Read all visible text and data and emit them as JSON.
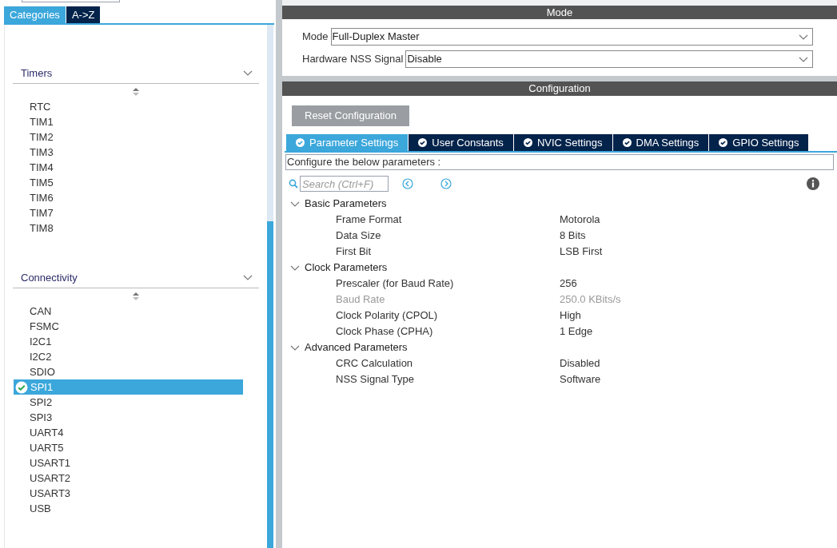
{
  "left_tabs": [
    {
      "label": "Categories",
      "selected": true
    },
    {
      "label": "A->Z",
      "selected": false
    }
  ],
  "categories": [
    {
      "label": "Timers",
      "expanded": true,
      "items": [
        {
          "label": "RTC",
          "selected": false,
          "configured": false
        },
        {
          "label": "TIM1",
          "selected": false,
          "configured": false
        },
        {
          "label": "TIM2",
          "selected": false,
          "configured": false
        },
        {
          "label": "TIM3",
          "selected": false,
          "configured": false
        },
        {
          "label": "TIM4",
          "selected": false,
          "configured": false
        },
        {
          "label": "TIM5",
          "selected": false,
          "configured": false
        },
        {
          "label": "TIM6",
          "selected": false,
          "configured": false
        },
        {
          "label": "TIM7",
          "selected": false,
          "configured": false
        },
        {
          "label": "TIM8",
          "selected": false,
          "configured": false
        }
      ]
    },
    {
      "label": "Connectivity",
      "expanded": true,
      "items": [
        {
          "label": "CAN",
          "selected": false,
          "configured": false
        },
        {
          "label": "FSMC",
          "selected": false,
          "configured": false
        },
        {
          "label": "I2C1",
          "selected": false,
          "configured": false
        },
        {
          "label": "I2C2",
          "selected": false,
          "configured": false
        },
        {
          "label": "SDIO",
          "selected": false,
          "configured": false
        },
        {
          "label": "SPI1",
          "selected": true,
          "configured": true
        },
        {
          "label": "SPI2",
          "selected": false,
          "configured": false
        },
        {
          "label": "SPI3",
          "selected": false,
          "configured": false
        },
        {
          "label": "UART4",
          "selected": false,
          "configured": false
        },
        {
          "label": "UART5",
          "selected": false,
          "configured": false
        },
        {
          "label": "USART1",
          "selected": false,
          "configured": false
        },
        {
          "label": "USART2",
          "selected": false,
          "configured": false
        },
        {
          "label": "USART3",
          "selected": false,
          "configured": false
        },
        {
          "label": "USB",
          "selected": false,
          "configured": false
        }
      ]
    }
  ],
  "mode": {
    "title": "Mode",
    "fields": [
      {
        "label": "Mode",
        "value": "Full-Duplex Master"
      },
      {
        "label": "Hardware NSS Signal",
        "value": "Disable"
      }
    ]
  },
  "configuration": {
    "title": "Configuration",
    "reset_button": "Reset Configuration",
    "tabs": [
      {
        "label": "Parameter Settings",
        "selected": true
      },
      {
        "label": "User Constants",
        "selected": false
      },
      {
        "label": "NVIC Settings",
        "selected": false
      },
      {
        "label": "DMA Settings",
        "selected": false
      },
      {
        "label": "GPIO Settings",
        "selected": false
      }
    ],
    "hint": "Configure the below parameters :",
    "search": {
      "placeholder": "Search (Ctrl+F)"
    },
    "groups": [
      {
        "label": "Basic Parameters",
        "expanded": true,
        "children": [
          {
            "name": "Frame Format",
            "value": "Motorola",
            "disabled": false
          },
          {
            "name": "Data Size",
            "value": "8 Bits",
            "disabled": false
          },
          {
            "name": "First Bit",
            "value": "LSB First",
            "disabled": false
          }
        ]
      },
      {
        "label": "Clock Parameters",
        "expanded": true,
        "children": [
          {
            "name": "Prescaler (for Baud Rate)",
            "value": "256",
            "disabled": false
          },
          {
            "name": "Baud Rate",
            "value": "250.0 KBits/s",
            "disabled": true
          },
          {
            "name": "Clock Polarity (CPOL)",
            "value": "High",
            "disabled": false
          },
          {
            "name": "Clock Phase (CPHA)",
            "value": "1 Edge",
            "disabled": false
          }
        ]
      },
      {
        "label": "Advanced Parameters",
        "expanded": true,
        "children": [
          {
            "name": "CRC Calculation",
            "value": "Disabled",
            "disabled": false
          },
          {
            "name": "NSS Signal Type",
            "value": "Software",
            "disabled": false
          }
        ]
      }
    ]
  }
}
